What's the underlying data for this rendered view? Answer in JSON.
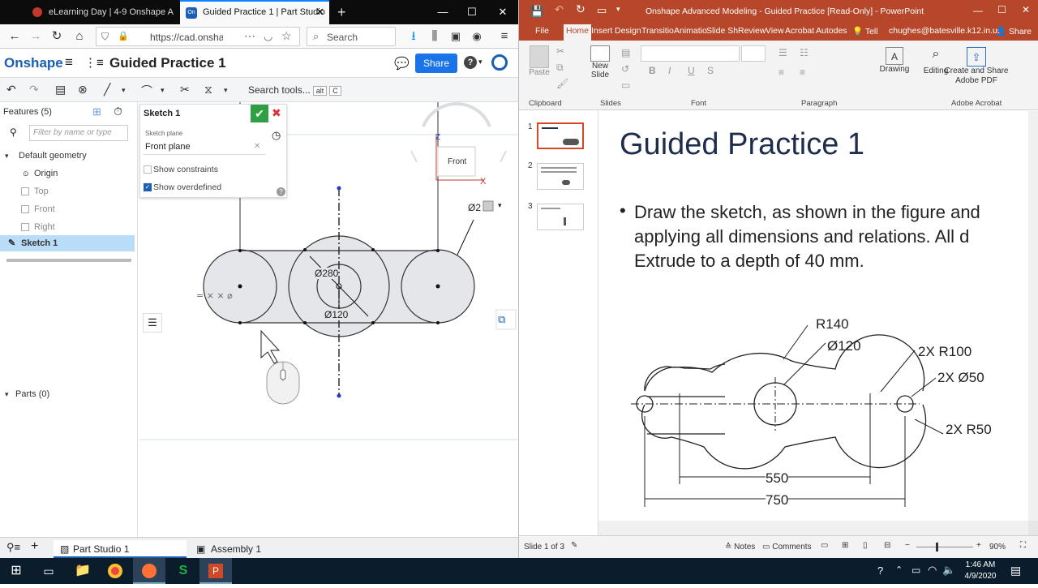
{
  "firefox": {
    "tabs": [
      {
        "title": "eLearning Day | 4-9 Onshape A"
      },
      {
        "title": "Guided Practice 1 | Part Studio"
      }
    ],
    "url": "https://cad.onsha",
    "search_placeholder": "Search",
    "window_controls": {
      "min": "—",
      "max": "☐",
      "close": "✕"
    }
  },
  "onshape": {
    "logo": "Onshape",
    "doc_title": "Guided Practice 1",
    "share_label": "Share",
    "search_tools": "Search tools...",
    "shortcut": [
      "alt",
      "C"
    ],
    "features": {
      "header": "Features (5)",
      "filter_placeholder": "Filter by name or type",
      "default_geometry": "Default geometry",
      "items": [
        {
          "label": "Origin"
        },
        {
          "label": "Top"
        },
        {
          "label": "Front"
        },
        {
          "label": "Right"
        },
        {
          "label": "Sketch 1"
        }
      ],
      "parts": "Parts (0)"
    },
    "sketch_panel": {
      "title": "Sketch 1",
      "plane_label": "Sketch plane",
      "plane_value": "Front plane",
      "show_constraints": "Show constraints",
      "show_overdefined": "Show overdefined",
      "show_constraints_checked": false,
      "show_overdefined_checked": true
    },
    "canvas": {
      "view_label": "Front",
      "axis_z": "Z",
      "axis_x": "X",
      "dim_280": "Ø280",
      "dim_120": "Ø120",
      "dim_2": "Ø2"
    },
    "bottom_tabs": [
      {
        "label": "Part Studio 1"
      },
      {
        "label": "Assembly 1"
      }
    ]
  },
  "powerpoint": {
    "title": "Onshape Advanced Modeling - Guided Practice [Read-Only] - PowerPoint",
    "tabs": [
      "File",
      "Home",
      "Insert",
      "Design",
      "Transitio",
      "Animatio",
      "Slide Sh",
      "Review",
      "View",
      "Acrobat",
      "Autodes"
    ],
    "tell": "Tell",
    "user": "chughes@batesville.k12.in.us",
    "share": "Share",
    "ribbon": {
      "paste": "Paste",
      "new_slide": "New Slide",
      "drawing": "Drawing",
      "editing": "Editing",
      "create_pdf": "Create and Share Adobe PDF",
      "groups": [
        "Clipboard",
        "Slides",
        "Font",
        "Paragraph",
        "Adobe Acrobat"
      ]
    },
    "thumb_numbers": [
      "1",
      "2",
      "3"
    ],
    "slide": {
      "title": "Guided Practice 1",
      "bullet_lines": [
        "Draw the sketch, as shown in the figure and",
        "applying all dimensions and relations. All d",
        "Extrude to a depth of 40 mm."
      ],
      "drawing_labels": {
        "r140": "R140",
        "d120": "Ø120",
        "r100": "2X R100",
        "d50": "2X Ø50",
        "r50": "2X R50",
        "len550": "550",
        "len750": "750"
      }
    },
    "status": {
      "slide_of": "Slide 1 of 3",
      "notes": "Notes",
      "comments": "Comments",
      "zoom": "90%"
    }
  },
  "taskbar": {
    "time": "1:46 AM",
    "date": "4/9/2020"
  }
}
